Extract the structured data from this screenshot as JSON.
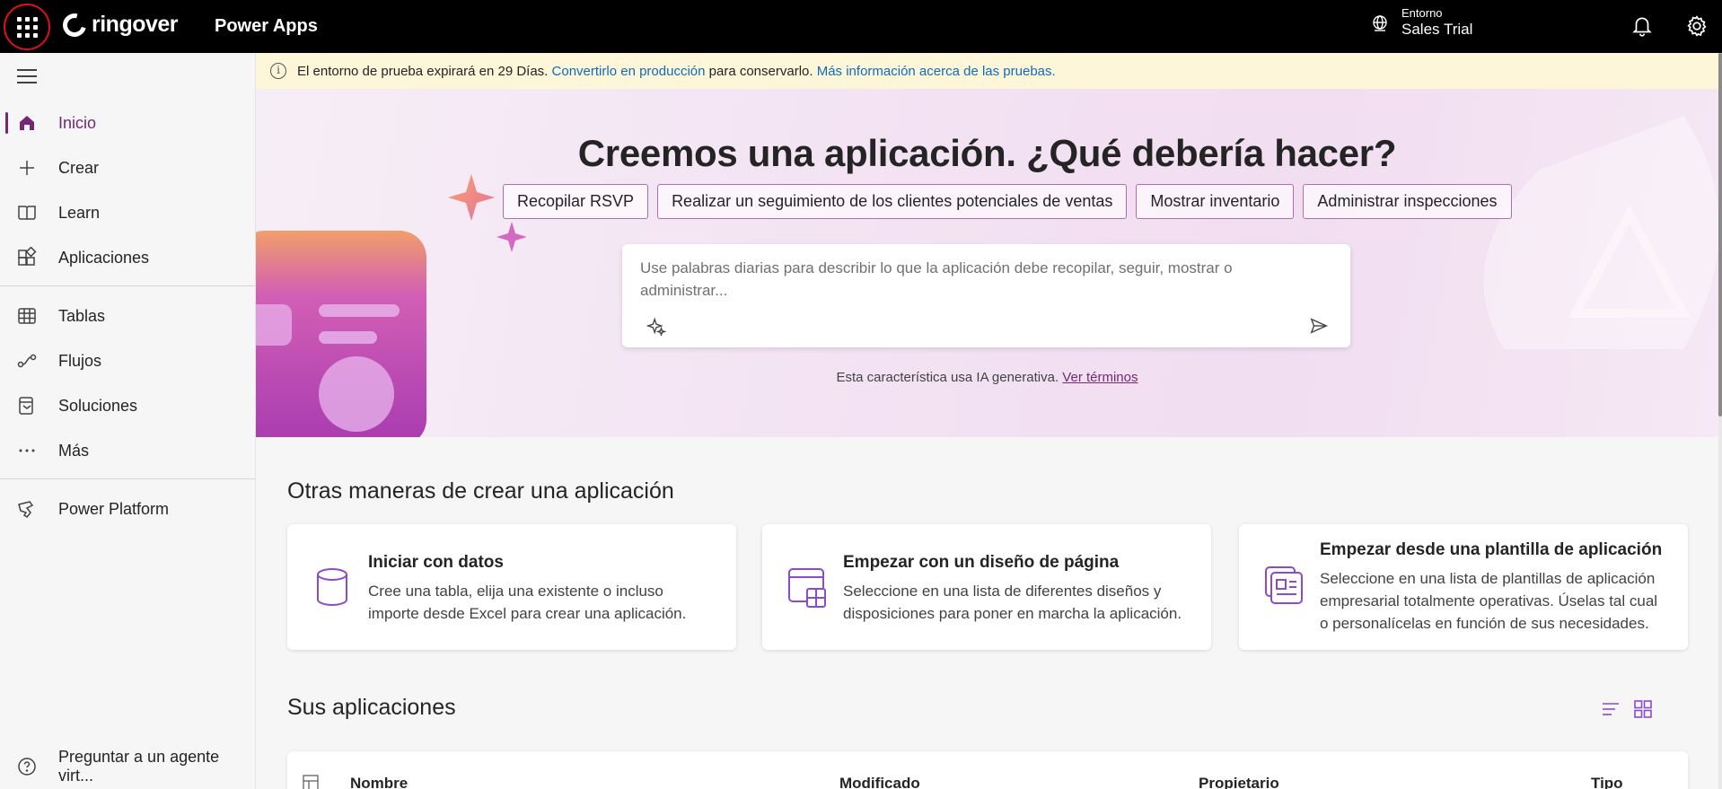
{
  "topbar": {
    "brand": "ringover",
    "app_name": "Power Apps",
    "environment_label": "Entorno",
    "environment_value": "Sales Trial"
  },
  "sidebar": {
    "items": [
      {
        "label": "Inicio",
        "icon": "home-icon",
        "active": true
      },
      {
        "label": "Crear",
        "icon": "plus-icon"
      },
      {
        "label": "Learn",
        "icon": "book-icon"
      },
      {
        "label": "Aplicaciones",
        "icon": "apps-icon"
      },
      {
        "label": "Tablas",
        "icon": "table-icon"
      },
      {
        "label": "Flujos",
        "icon": "flows-icon"
      },
      {
        "label": "Soluciones",
        "icon": "solutions-icon"
      },
      {
        "label": "Más",
        "icon": "more-icon"
      },
      {
        "label": "Power Platform",
        "icon": "power-platform-icon"
      }
    ],
    "footer_label": "Preguntar a un agente virt..."
  },
  "banner": {
    "text": "El entorno de prueba expirará en 29 Días.",
    "link1": "Convertirlo en producción",
    "middle": "para conservarlo.",
    "link2": "Más información acerca de las pruebas."
  },
  "hero": {
    "title": "Creemos una aplicación. ¿Qué debería hacer?",
    "chips": [
      "Recopilar RSVP",
      "Realizar un seguimiento de los clientes potenciales de ventas",
      "Mostrar inventario",
      "Administrar inspecciones"
    ],
    "prompt_placeholder": "Use palabras diarias para describir lo que la aplicación debe recopilar, seguir, mostrar o administrar...",
    "ai_note": "Esta característica usa IA generativa.",
    "ai_link": "Ver términos"
  },
  "other_ways": {
    "title": "Otras maneras de crear una aplicación",
    "cards": [
      {
        "title": "Iniciar con datos",
        "desc": "Cree una tabla, elija una existente o incluso importe desde Excel para crear una aplicación."
      },
      {
        "title": "Empezar con un diseño de página",
        "desc": "Seleccione en una lista de diferentes diseños y disposiciones para poner en marcha la aplicación."
      },
      {
        "title": "Empezar desde una plantilla de aplicación",
        "desc": "Seleccione en una lista de plantillas de aplicación empresarial totalmente operativas. Úselas tal cual o personalícelas en función de sus necesidades."
      }
    ]
  },
  "apps": {
    "title": "Sus aplicaciones",
    "columns": [
      "Nombre",
      "Modificado",
      "Propietario",
      "Tipo"
    ]
  },
  "colors": {
    "accent": "#742774",
    "link": "#0f6cbd",
    "banner_bg": "#fdf6d8",
    "topbar_bg": "#000000"
  }
}
